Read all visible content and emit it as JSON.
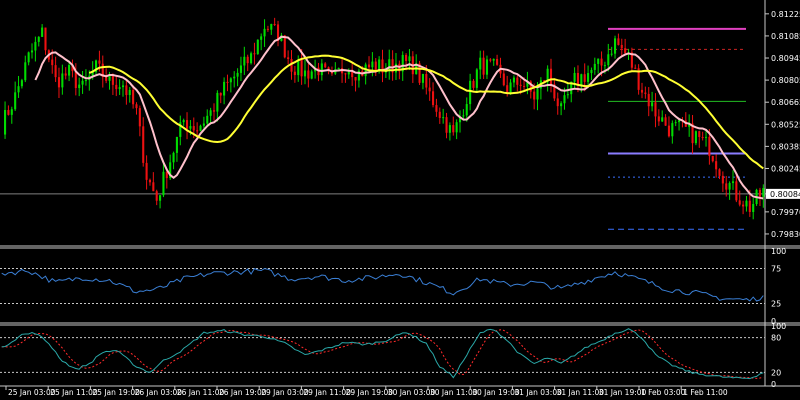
{
  "chart_data": {
    "type": "candlestick",
    "colors": {
      "background": "#000000",
      "bull": "#00dd00",
      "bear": "#ee1111",
      "ma_fast": "#ffc0cb",
      "ma_slow": "#ffff33",
      "rsi": "#3a7fd5",
      "stoch_main": "#2aa8a8",
      "stoch_signal": "#ff2a2a",
      "level_magenta": "#e040c0",
      "level_green": "#22bb22",
      "level_purple": "#8a7cff",
      "level_blue": "#3a70ff",
      "dashed_red": "#cc2222"
    },
    "main_panel": {
      "y_range": [
        0.7976,
        0.813
      ],
      "y_ticks": [
        "0.81225",
        "0.81085",
        "0.80945",
        "0.80805",
        "0.80665",
        "0.80525",
        "0.80385",
        "0.80245",
        "0.80084",
        "0.79970",
        "0.79830"
      ],
      "y_tick_values": [
        0.81225,
        0.81085,
        0.80945,
        0.80805,
        0.80665,
        0.80525,
        0.80385,
        0.80245,
        0.80084,
        0.7997,
        0.7983
      ],
      "current_price": "0.80084",
      "levels": {
        "magenta": 0.8113,
        "red_dashed_upper": 0.81,
        "green": 0.8067,
        "purple": 0.8034,
        "blue_dotted": 0.8019,
        "blue_dashed_lower": 0.7986
      }
    },
    "rsi_panel": {
      "y_range": [
        0,
        100
      ],
      "y_ticks": [
        "100",
        "75",
        "25",
        "0"
      ],
      "y_tick_values": [
        100,
        75,
        25,
        0
      ],
      "levels": [
        75,
        25
      ]
    },
    "stoch_panel": {
      "y_range": [
        0,
        100
      ],
      "y_ticks": [
        "100",
        "80",
        "20",
        "0"
      ],
      "y_tick_values": [
        100,
        80,
        20,
        0
      ],
      "levels": [
        80,
        20
      ]
    },
    "time_labels": [
      "25 Jan 03:00",
      "25 Jan 11:00",
      "25 Jan 19:00",
      "26 Jan 03:00",
      "26 Jan 11:00",
      "26 Jan 19:00",
      "29 Jan 03:00",
      "29 Jan 11:00",
      "29 Jan 19:00",
      "30 Jan 03:00",
      "30 Jan 11:00",
      "30 Jan 19:00",
      "31 Jan 03:00",
      "31 Jan 11:00",
      "31 Jan 19:00",
      "1 Feb 03:00",
      "1 Feb 11:00"
    ],
    "close_path": [
      [
        0,
        0.8052
      ],
      [
        4,
        0.807
      ],
      [
        8,
        0.8095
      ],
      [
        12,
        0.811
      ],
      [
        16,
        0.808
      ],
      [
        20,
        0.8085
      ],
      [
        24,
        0.8075
      ],
      [
        28,
        0.8088
      ],
      [
        32,
        0.808
      ],
      [
        36,
        0.8078
      ],
      [
        40,
        0.806
      ],
      [
        43,
        0.802
      ],
      [
        46,
        0.8005
      ],
      [
        50,
        0.803
      ],
      [
        54,
        0.8055
      ],
      [
        58,
        0.805
      ],
      [
        62,
        0.806
      ],
      [
        66,
        0.8075
      ],
      [
        70,
        0.8085
      ],
      [
        74,
        0.8095
      ],
      [
        78,
        0.8115
      ],
      [
        82,
        0.811
      ],
      [
        86,
        0.809
      ],
      [
        90,
        0.8085
      ],
      [
        94,
        0.8088
      ],
      [
        98,
        0.808
      ],
      [
        102,
        0.809
      ],
      [
        106,
        0.8085
      ],
      [
        110,
        0.809
      ],
      [
        114,
        0.8088
      ],
      [
        118,
        0.8092
      ],
      [
        122,
        0.809
      ],
      [
        126,
        0.8075
      ],
      [
        130,
        0.806
      ],
      [
        134,
        0.8045
      ],
      [
        138,
        0.807
      ],
      [
        142,
        0.809
      ],
      [
        146,
        0.8088
      ],
      [
        150,
        0.8075
      ],
      [
        154,
        0.808
      ],
      [
        158,
        0.807
      ],
      [
        162,
        0.8085
      ],
      [
        166,
        0.806
      ],
      [
        170,
        0.808
      ],
      [
        174,
        0.8085
      ],
      [
        178,
        0.809
      ],
      [
        182,
        0.8105
      ],
      [
        186,
        0.8095
      ],
      [
        190,
        0.8075
      ],
      [
        194,
        0.806
      ],
      [
        198,
        0.805
      ],
      [
        202,
        0.805
      ],
      [
        206,
        0.8045
      ],
      [
        210,
        0.8038
      ],
      [
        214,
        0.802
      ],
      [
        218,
        0.8008
      ],
      [
        222,
        0.8
      ],
      [
        226,
        0.801
      ]
    ],
    "rsi_path": [
      [
        0,
        68
      ],
      [
        8,
        72
      ],
      [
        16,
        55
      ],
      [
        24,
        62
      ],
      [
        32,
        58
      ],
      [
        40,
        42
      ],
      [
        46,
        45
      ],
      [
        54,
        60
      ],
      [
        62,
        68
      ],
      [
        70,
        70
      ],
      [
        78,
        72
      ],
      [
        86,
        60
      ],
      [
        94,
        64
      ],
      [
        102,
        58
      ],
      [
        110,
        62
      ],
      [
        118,
        68
      ],
      [
        126,
        55
      ],
      [
        134,
        40
      ],
      [
        142,
        60
      ],
      [
        150,
        52
      ],
      [
        158,
        55
      ],
      [
        166,
        46
      ],
      [
        174,
        58
      ],
      [
        182,
        70
      ],
      [
        190,
        58
      ],
      [
        198,
        45
      ],
      [
        206,
        40
      ],
      [
        214,
        32
      ],
      [
        222,
        30
      ],
      [
        226,
        35
      ]
    ],
    "stoch_main_path": [
      [
        0,
        62
      ],
      [
        6,
        85
      ],
      [
        10,
        88
      ],
      [
        14,
        70
      ],
      [
        18,
        40
      ],
      [
        22,
        25
      ],
      [
        26,
        35
      ],
      [
        30,
        55
      ],
      [
        34,
        58
      ],
      [
        40,
        30
      ],
      [
        44,
        20
      ],
      [
        48,
        40
      ],
      [
        54,
        60
      ],
      [
        60,
        88
      ],
      [
        66,
        92
      ],
      [
        72,
        85
      ],
      [
        78,
        82
      ],
      [
        84,
        70
      ],
      [
        90,
        50
      ],
      [
        96,
        60
      ],
      [
        102,
        72
      ],
      [
        108,
        68
      ],
      [
        114,
        75
      ],
      [
        120,
        90
      ],
      [
        126,
        70
      ],
      [
        130,
        30
      ],
      [
        134,
        12
      ],
      [
        138,
        50
      ],
      [
        142,
        88
      ],
      [
        146,
        95
      ],
      [
        150,
        75
      ],
      [
        154,
        50
      ],
      [
        158,
        35
      ],
      [
        162,
        45
      ],
      [
        166,
        35
      ],
      [
        170,
        50
      ],
      [
        174,
        65
      ],
      [
        178,
        75
      ],
      [
        182,
        88
      ],
      [
        186,
        95
      ],
      [
        190,
        80
      ],
      [
        194,
        50
      ],
      [
        198,
        35
      ],
      [
        202,
        25
      ],
      [
        206,
        18
      ],
      [
        210,
        15
      ],
      [
        214,
        12
      ],
      [
        218,
        10
      ],
      [
        222,
        10
      ],
      [
        226,
        20
      ]
    ]
  }
}
